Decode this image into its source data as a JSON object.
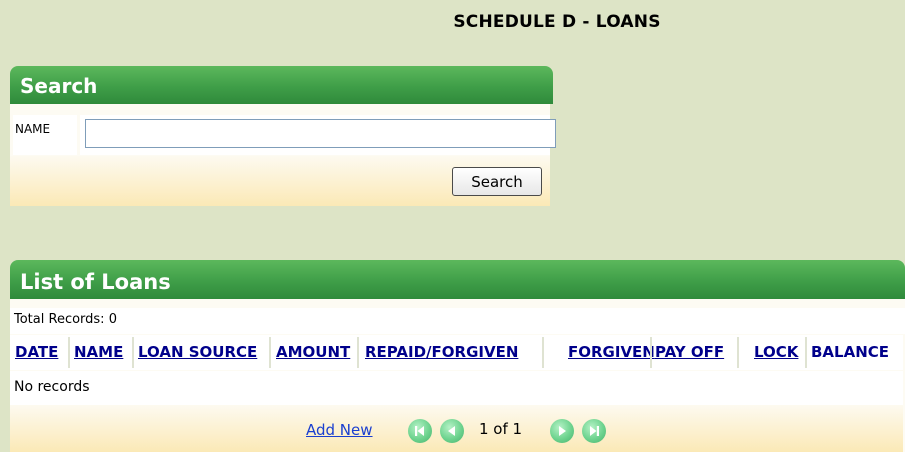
{
  "page_title": "SCHEDULE D - LOANS",
  "search": {
    "title": "Search",
    "name_label": "NAME",
    "name_value": "",
    "button_label": "Search"
  },
  "loans": {
    "title": "List of Loans",
    "total_label": "Total Records:",
    "total_value": "0",
    "columns": [
      "DATE",
      "NAME",
      "LOAN SOURCE",
      "AMOUNT",
      "REPAID/FORGIVEN",
      "FORGIVEN",
      "PAY OFF",
      "LOCK",
      "BALANCE"
    ],
    "empty_text": "No records",
    "add_new_label": "Add New",
    "pager_text": "1 of 1"
  },
  "icons": {
    "first": "first-page-icon",
    "prev": "previous-page-icon",
    "next": "next-page-icon",
    "last": "last-page-icon"
  },
  "colors": {
    "panel_header": "#3f9e48",
    "background": "#dde4c6",
    "link": "#1a3fd0",
    "column_header": "#00008b"
  }
}
